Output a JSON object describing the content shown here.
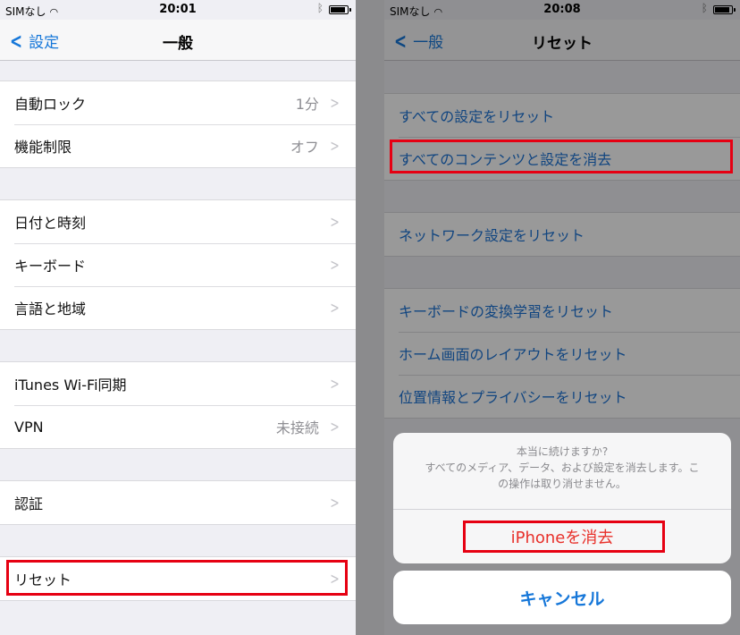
{
  "left_screen": {
    "status": {
      "carrier": "SIMなし",
      "time": "20:01"
    },
    "navbar": {
      "back_label": "設定",
      "title": "一般"
    },
    "groups": [
      [
        {
          "label": "自動ロック",
          "value": "1分"
        },
        {
          "label": "機能制限",
          "value": "オフ"
        }
      ],
      [
        {
          "label": "日付と時刻",
          "value": ""
        },
        {
          "label": "キーボード",
          "value": ""
        },
        {
          "label": "言語と地域",
          "value": ""
        }
      ],
      [
        {
          "label": "iTunes Wi-Fi同期",
          "value": ""
        },
        {
          "label": "VPN",
          "value": "未接続"
        }
      ],
      [
        {
          "label": "認証",
          "value": ""
        }
      ],
      [
        {
          "label": "リセット",
          "value": "",
          "highlighted": true
        }
      ]
    ]
  },
  "right_screen": {
    "status": {
      "carrier": "SIMなし",
      "time": "20:08"
    },
    "navbar": {
      "back_label": "一般",
      "title": "リセット"
    },
    "groups": [
      [
        {
          "label": "すべての設定をリセット"
        },
        {
          "label": "すべてのコンテンツと設定を消去",
          "highlighted": true
        }
      ],
      [
        {
          "label": "ネットワーク設定をリセット"
        }
      ],
      [
        {
          "label": "キーボードの変換学習をリセット"
        },
        {
          "label": "ホーム画面のレイアウトをリセット"
        },
        {
          "label": "位置情報とプライバシーをリセット"
        }
      ]
    ],
    "action_sheet": {
      "message_line1": "本当に続けますか?",
      "message_line2": "すべてのメディア、データ、および設定を消去します。こ",
      "message_line3": "の操作は取り消せません。",
      "destructive_label": "iPhoneを消去",
      "cancel_label": "キャンセル"
    }
  },
  "colors": {
    "ios_blue": "#1677d9",
    "destructive_red": "#e8302a",
    "highlight_red": "#e60012",
    "grouped_background": "#efeff4"
  },
  "icons": {
    "wifi": "wifi-icon",
    "bluetooth": "bluetooth-icon",
    "battery": "battery-icon",
    "back": "chevron-left-icon",
    "disclosure": "chevron-right-icon"
  }
}
